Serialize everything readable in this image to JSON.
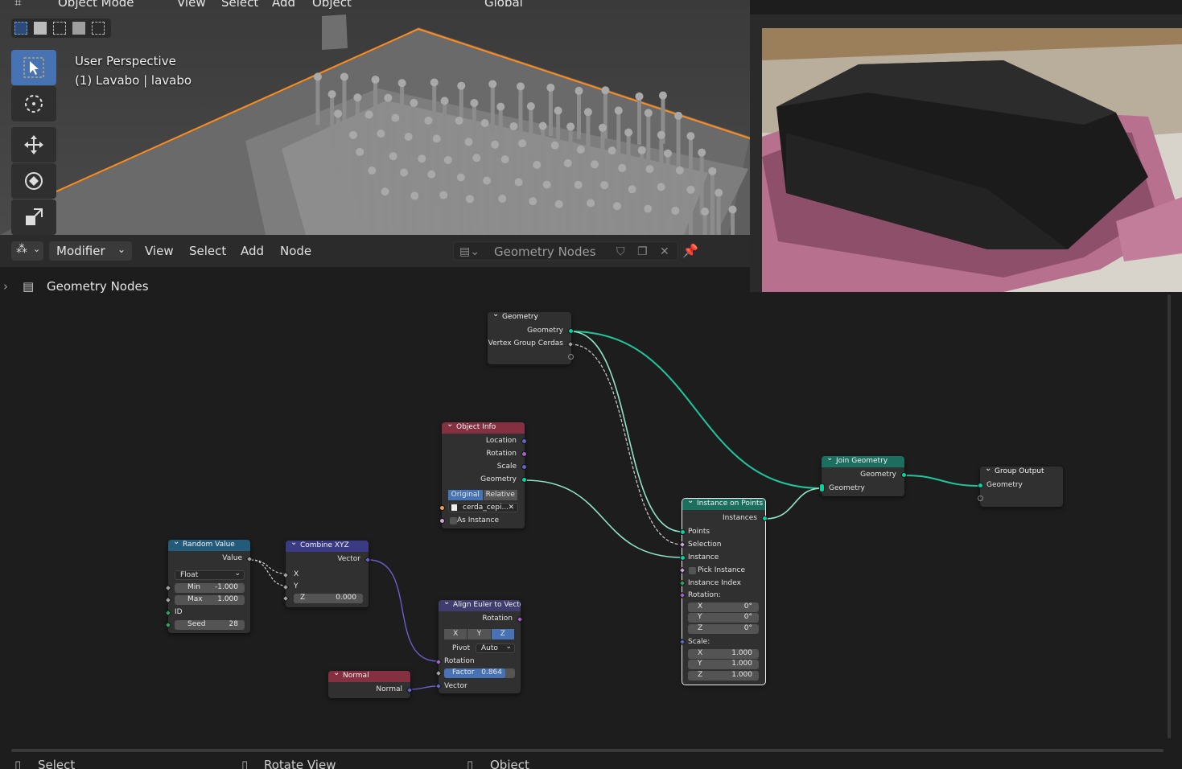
{
  "viewport": {
    "header": {
      "mode": "Object Mode",
      "view": "View",
      "select": "Select",
      "add": "Add",
      "object": "Object",
      "orientation": "Global"
    },
    "info_line1": "User Perspective",
    "info_line2": "(1) Lavabo | lavabo"
  },
  "node_editor": {
    "editor_type_icon": "node-editor-icon",
    "mode": "Modifier",
    "menus": {
      "view": "View",
      "select": "Select",
      "add": "Add",
      "node": "Node"
    },
    "tree_name": "Geometry Nodes",
    "breadcrumb": "Geometry Nodes"
  },
  "nodes": {
    "group_input": {
      "title": "Geometry",
      "out_geometry": "Geometry",
      "out_vertex_group": "Vertex Group Cerdas"
    },
    "object_info": {
      "title": "Object Info",
      "location": "Location",
      "rotation": "Rotation",
      "scale": "Scale",
      "geometry": "Geometry",
      "original": "Original",
      "relative": "Relative",
      "object": "cerda_cepi...",
      "as_instance": "As Instance"
    },
    "random_value": {
      "title": "Random Value",
      "value": "Value",
      "type": "Float",
      "min_label": "Min",
      "min": "-1.000",
      "max_label": "Max",
      "max": "1.000",
      "id": "ID",
      "seed_label": "Seed",
      "seed": "28"
    },
    "combine_xyz": {
      "title": "Combine XYZ",
      "vector": "Vector",
      "x": "X",
      "y": "Y",
      "z_label": "Z",
      "z": "0.000"
    },
    "align_euler": {
      "title": "Align Euler to Vector",
      "rotation_out": "Rotation",
      "ax": "X",
      "ay": "Y",
      "az": "Z",
      "pivot_label": "Pivot",
      "pivot": "Auto",
      "rotation_in": "Rotation",
      "factor_label": "Factor",
      "factor": "0.864",
      "vector": "Vector"
    },
    "normal": {
      "title": "Normal",
      "normal": "Normal"
    },
    "instance_on_points": {
      "title": "Instance on Points",
      "instances": "Instances",
      "points": "Points",
      "selection": "Selection",
      "instance": "Instance",
      "pick_instance": "Pick Instance",
      "instance_index": "Instance Index",
      "rotation": "Rotation:",
      "rx_label": "X",
      "rx": "0°",
      "ry_label": "Y",
      "ry": "0°",
      "rz_label": "Z",
      "rz": "0°",
      "scale": "Scale:",
      "sx_label": "X",
      "sx": "1.000",
      "sy_label": "Y",
      "sy": "1.000",
      "sz_label": "Z",
      "sz": "1.000"
    },
    "join_geometry": {
      "title": "Join Geometry",
      "out": "Geometry",
      "in": "Geometry"
    },
    "group_output": {
      "title": "Group Output",
      "geometry": "Geometry"
    }
  },
  "status_bar": {
    "select": "Select",
    "rotate_view": "Rotate View",
    "object": "Object"
  },
  "colors": {
    "geometry_socket": "#00d6a3",
    "vector_socket": "#6363c7",
    "selection_outline": "#ff8c1a",
    "accent": "#4772b3"
  }
}
